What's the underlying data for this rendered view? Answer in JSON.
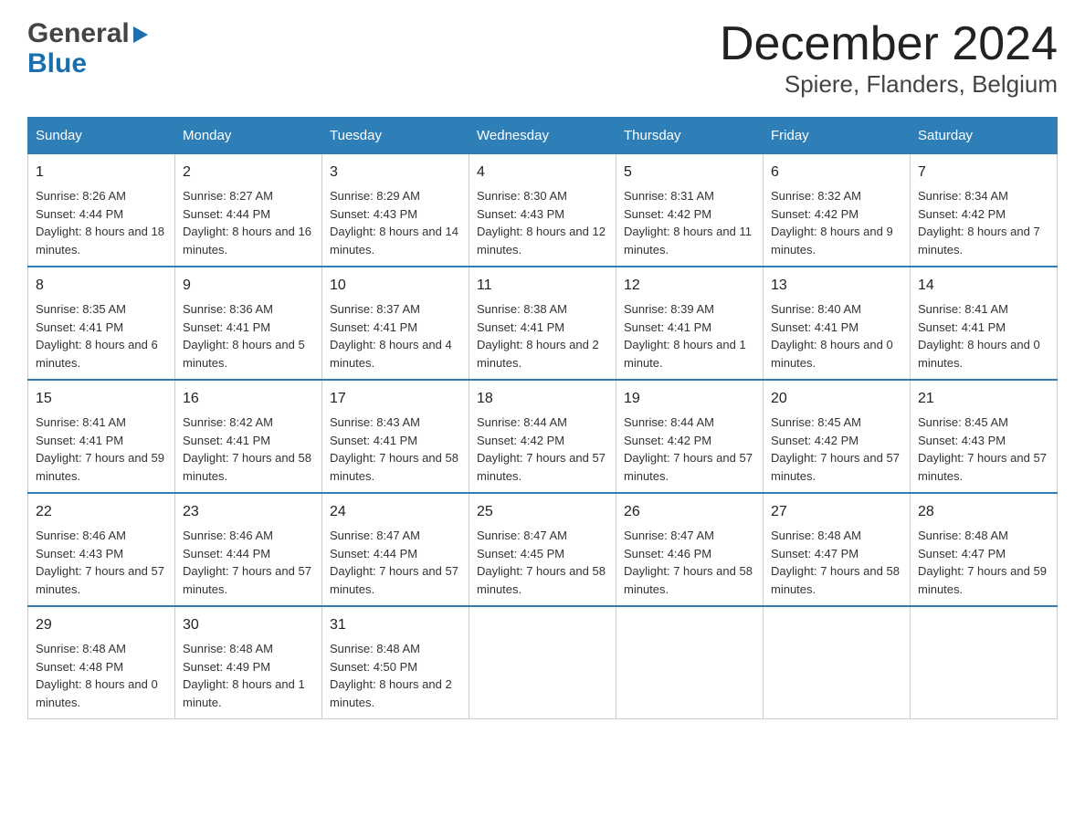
{
  "header": {
    "logo_general": "General",
    "logo_blue": "Blue",
    "title": "December 2024",
    "subtitle": "Spiere, Flanders, Belgium"
  },
  "days": [
    "Sunday",
    "Monday",
    "Tuesday",
    "Wednesday",
    "Thursday",
    "Friday",
    "Saturday"
  ],
  "weeks": [
    [
      {
        "date": "1",
        "sunrise": "Sunrise: 8:26 AM",
        "sunset": "Sunset: 4:44 PM",
        "daylight": "Daylight: 8 hours and 18 minutes."
      },
      {
        "date": "2",
        "sunrise": "Sunrise: 8:27 AM",
        "sunset": "Sunset: 4:44 PM",
        "daylight": "Daylight: 8 hours and 16 minutes."
      },
      {
        "date": "3",
        "sunrise": "Sunrise: 8:29 AM",
        "sunset": "Sunset: 4:43 PM",
        "daylight": "Daylight: 8 hours and 14 minutes."
      },
      {
        "date": "4",
        "sunrise": "Sunrise: 8:30 AM",
        "sunset": "Sunset: 4:43 PM",
        "daylight": "Daylight: 8 hours and 12 minutes."
      },
      {
        "date": "5",
        "sunrise": "Sunrise: 8:31 AM",
        "sunset": "Sunset: 4:42 PM",
        "daylight": "Daylight: 8 hours and 11 minutes."
      },
      {
        "date": "6",
        "sunrise": "Sunrise: 8:32 AM",
        "sunset": "Sunset: 4:42 PM",
        "daylight": "Daylight: 8 hours and 9 minutes."
      },
      {
        "date": "7",
        "sunrise": "Sunrise: 8:34 AM",
        "sunset": "Sunset: 4:42 PM",
        "daylight": "Daylight: 8 hours and 7 minutes."
      }
    ],
    [
      {
        "date": "8",
        "sunrise": "Sunrise: 8:35 AM",
        "sunset": "Sunset: 4:41 PM",
        "daylight": "Daylight: 8 hours and 6 minutes."
      },
      {
        "date": "9",
        "sunrise": "Sunrise: 8:36 AM",
        "sunset": "Sunset: 4:41 PM",
        "daylight": "Daylight: 8 hours and 5 minutes."
      },
      {
        "date": "10",
        "sunrise": "Sunrise: 8:37 AM",
        "sunset": "Sunset: 4:41 PM",
        "daylight": "Daylight: 8 hours and 4 minutes."
      },
      {
        "date": "11",
        "sunrise": "Sunrise: 8:38 AM",
        "sunset": "Sunset: 4:41 PM",
        "daylight": "Daylight: 8 hours and 2 minutes."
      },
      {
        "date": "12",
        "sunrise": "Sunrise: 8:39 AM",
        "sunset": "Sunset: 4:41 PM",
        "daylight": "Daylight: 8 hours and 1 minute."
      },
      {
        "date": "13",
        "sunrise": "Sunrise: 8:40 AM",
        "sunset": "Sunset: 4:41 PM",
        "daylight": "Daylight: 8 hours and 0 minutes."
      },
      {
        "date": "14",
        "sunrise": "Sunrise: 8:41 AM",
        "sunset": "Sunset: 4:41 PM",
        "daylight": "Daylight: 8 hours and 0 minutes."
      }
    ],
    [
      {
        "date": "15",
        "sunrise": "Sunrise: 8:41 AM",
        "sunset": "Sunset: 4:41 PM",
        "daylight": "Daylight: 7 hours and 59 minutes."
      },
      {
        "date": "16",
        "sunrise": "Sunrise: 8:42 AM",
        "sunset": "Sunset: 4:41 PM",
        "daylight": "Daylight: 7 hours and 58 minutes."
      },
      {
        "date": "17",
        "sunrise": "Sunrise: 8:43 AM",
        "sunset": "Sunset: 4:41 PM",
        "daylight": "Daylight: 7 hours and 58 minutes."
      },
      {
        "date": "18",
        "sunrise": "Sunrise: 8:44 AM",
        "sunset": "Sunset: 4:42 PM",
        "daylight": "Daylight: 7 hours and 57 minutes."
      },
      {
        "date": "19",
        "sunrise": "Sunrise: 8:44 AM",
        "sunset": "Sunset: 4:42 PM",
        "daylight": "Daylight: 7 hours and 57 minutes."
      },
      {
        "date": "20",
        "sunrise": "Sunrise: 8:45 AM",
        "sunset": "Sunset: 4:42 PM",
        "daylight": "Daylight: 7 hours and 57 minutes."
      },
      {
        "date": "21",
        "sunrise": "Sunrise: 8:45 AM",
        "sunset": "Sunset: 4:43 PM",
        "daylight": "Daylight: 7 hours and 57 minutes."
      }
    ],
    [
      {
        "date": "22",
        "sunrise": "Sunrise: 8:46 AM",
        "sunset": "Sunset: 4:43 PM",
        "daylight": "Daylight: 7 hours and 57 minutes."
      },
      {
        "date": "23",
        "sunrise": "Sunrise: 8:46 AM",
        "sunset": "Sunset: 4:44 PM",
        "daylight": "Daylight: 7 hours and 57 minutes."
      },
      {
        "date": "24",
        "sunrise": "Sunrise: 8:47 AM",
        "sunset": "Sunset: 4:44 PM",
        "daylight": "Daylight: 7 hours and 57 minutes."
      },
      {
        "date": "25",
        "sunrise": "Sunrise: 8:47 AM",
        "sunset": "Sunset: 4:45 PM",
        "daylight": "Daylight: 7 hours and 58 minutes."
      },
      {
        "date": "26",
        "sunrise": "Sunrise: 8:47 AM",
        "sunset": "Sunset: 4:46 PM",
        "daylight": "Daylight: 7 hours and 58 minutes."
      },
      {
        "date": "27",
        "sunrise": "Sunrise: 8:48 AM",
        "sunset": "Sunset: 4:47 PM",
        "daylight": "Daylight: 7 hours and 58 minutes."
      },
      {
        "date": "28",
        "sunrise": "Sunrise: 8:48 AM",
        "sunset": "Sunset: 4:47 PM",
        "daylight": "Daylight: 7 hours and 59 minutes."
      }
    ],
    [
      {
        "date": "29",
        "sunrise": "Sunrise: 8:48 AM",
        "sunset": "Sunset: 4:48 PM",
        "daylight": "Daylight: 8 hours and 0 minutes."
      },
      {
        "date": "30",
        "sunrise": "Sunrise: 8:48 AM",
        "sunset": "Sunset: 4:49 PM",
        "daylight": "Daylight: 8 hours and 1 minute."
      },
      {
        "date": "31",
        "sunrise": "Sunrise: 8:48 AM",
        "sunset": "Sunset: 4:50 PM",
        "daylight": "Daylight: 8 hours and 2 minutes."
      },
      null,
      null,
      null,
      null
    ]
  ]
}
